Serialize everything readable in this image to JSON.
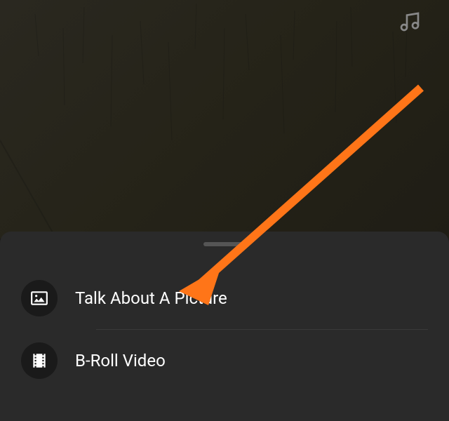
{
  "topBar": {
    "musicIcon": "music-icon"
  },
  "bottomSheet": {
    "items": [
      {
        "icon": "picture-icon",
        "label": "Talk About A Picture"
      },
      {
        "icon": "film-icon",
        "label": "B-Roll Video"
      }
    ]
  },
  "annotation": {
    "arrowColor": "#ff7518"
  }
}
